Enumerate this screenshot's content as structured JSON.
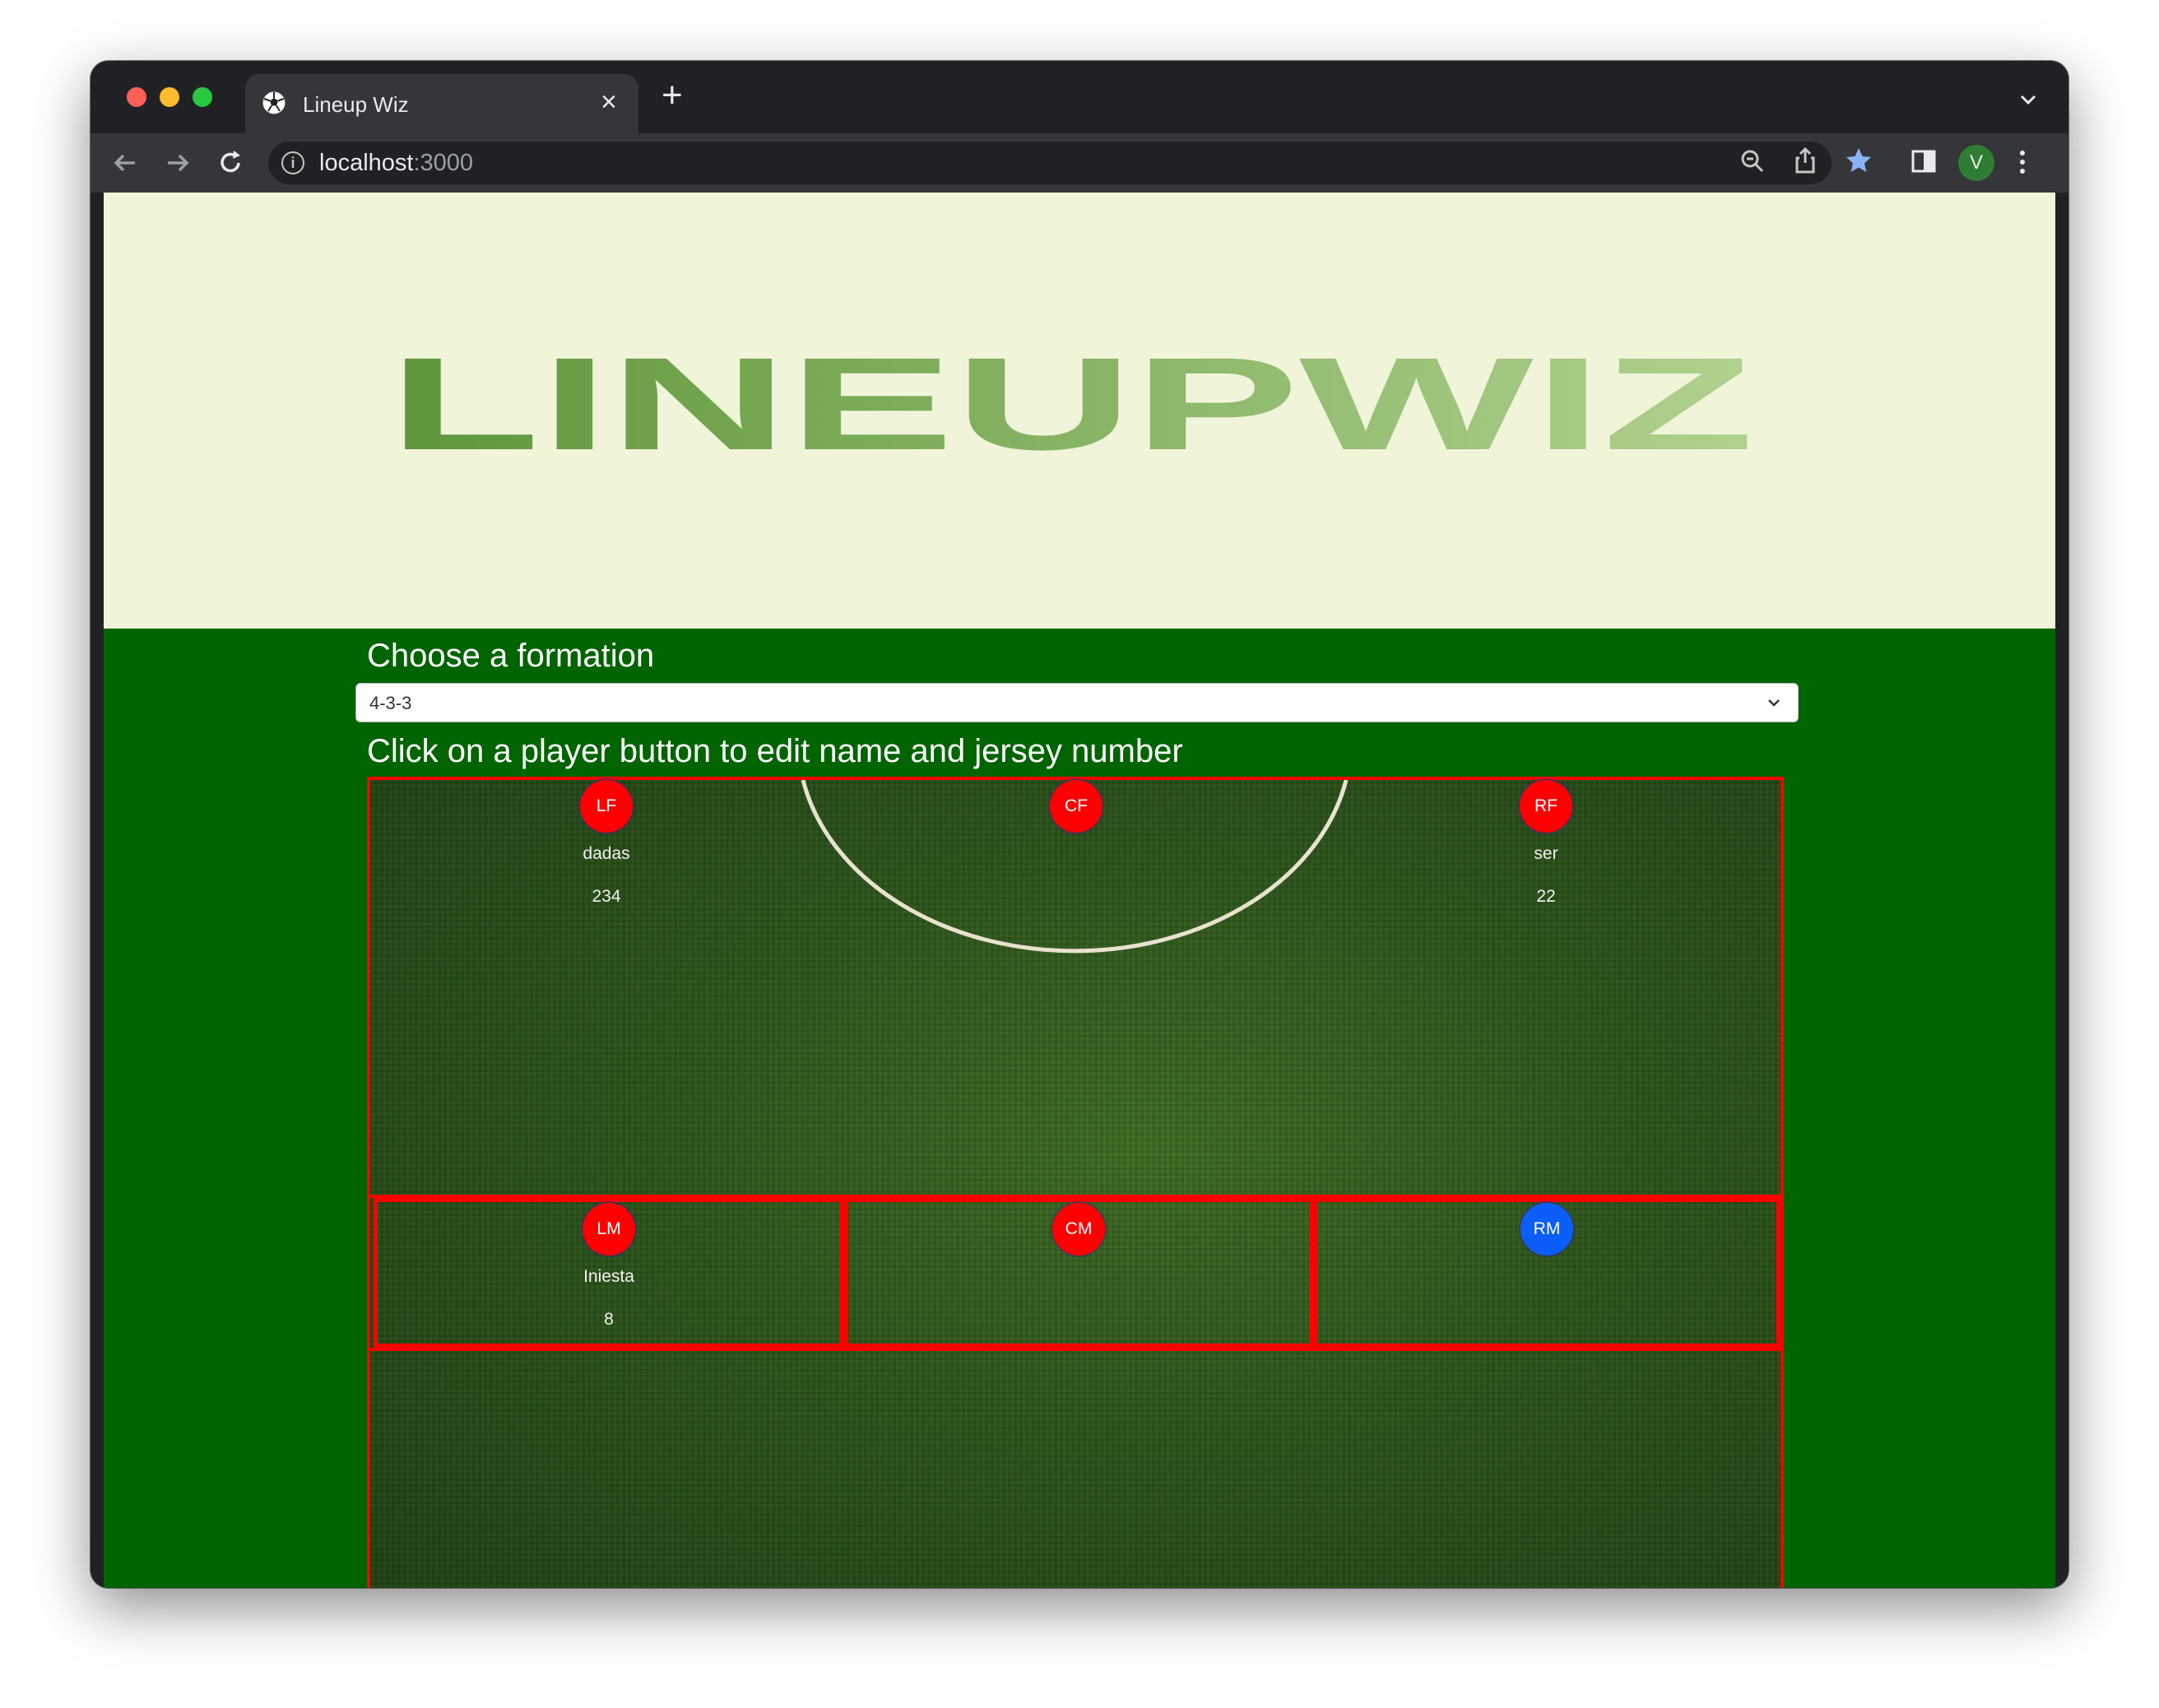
{
  "browser": {
    "tab_title": "Lineup Wiz",
    "url_host": "localhost",
    "url_port": ":3000",
    "profile_initial": "V"
  },
  "app": {
    "logo_text": "LINEUPWIZ",
    "choose_formation_label": "Choose a formation",
    "formation_selected": "4-3-3",
    "instructions": "Click on a player button to edit name and jersey number"
  },
  "forwards": [
    {
      "position": "LF",
      "name": "dadas",
      "number": "234",
      "color": "#ff0000"
    },
    {
      "position": "CF",
      "name": "",
      "number": "",
      "color": "#ff0000"
    },
    {
      "position": "RF",
      "name": "ser",
      "number": "22",
      "color": "#ff0000"
    }
  ],
  "midfielders": [
    {
      "position": "LM",
      "name": "Iniesta",
      "number": "8",
      "color": "#ff0000"
    },
    {
      "position": "CM",
      "name": "",
      "number": "",
      "color": "#ff0000"
    },
    {
      "position": "RM",
      "name": "",
      "number": "",
      "color": "#0b5ef7"
    }
  ],
  "colors": {
    "page_background": "#006400",
    "banner_background": "#f0f5da",
    "zone_border": "#ff0000",
    "selected_player": "#0b5ef7"
  }
}
